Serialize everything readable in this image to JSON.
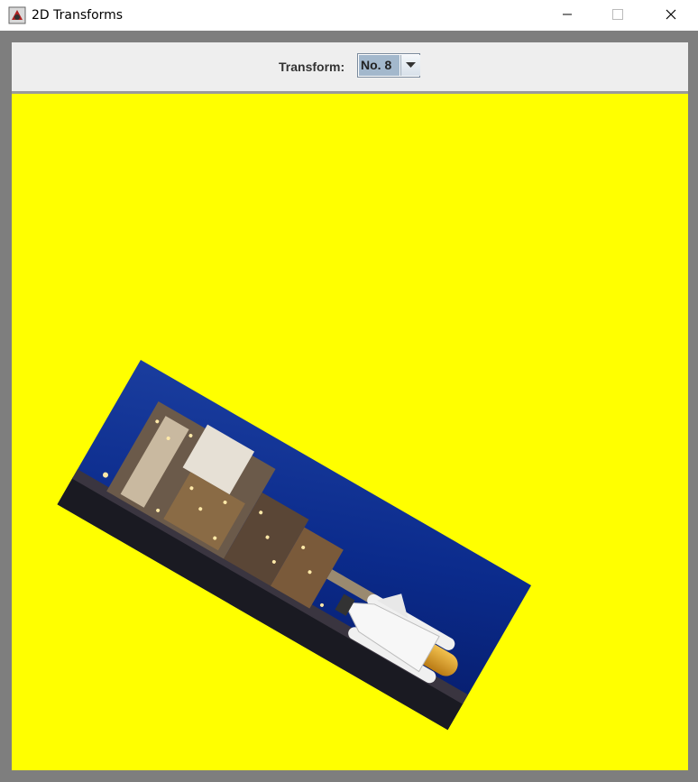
{
  "window": {
    "title": "2D Transforms",
    "icon": "java-app-icon",
    "controls": [
      "minimize-icon",
      "maximize-icon",
      "close-icon"
    ]
  },
  "toolbar": {
    "transform_label": "Transform:",
    "transform_selected": "No. 8"
  },
  "canvas": {
    "background": "#ffff00",
    "image": {
      "subject": "space shuttle on launch pad at night",
      "rotation_deg": 30
    }
  }
}
